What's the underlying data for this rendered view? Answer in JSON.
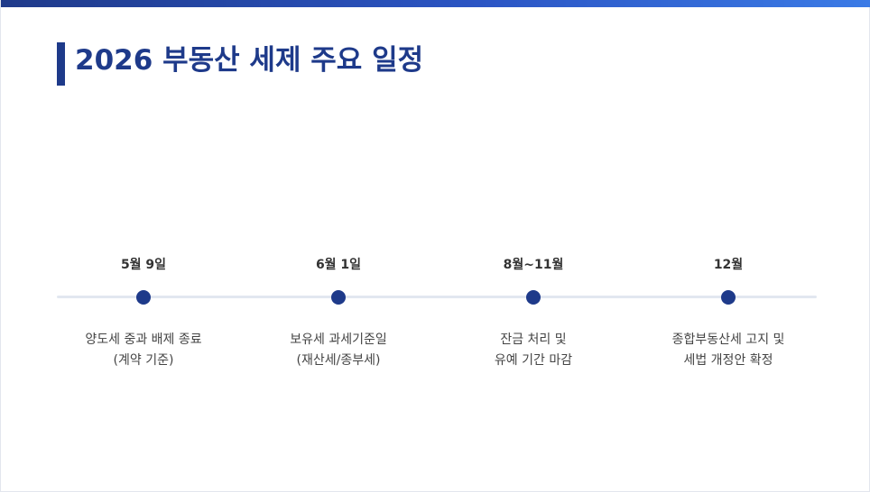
{
  "slide": {
    "title": "2026 부동산 세제 주요 일정",
    "colors": {
      "accent": "#1e3a8a",
      "timeline_line": "#e2e7f0",
      "top_bar_start": "#1f3a8a",
      "top_bar_end": "#3b7be6"
    }
  },
  "timeline": [
    {
      "date": "5월 9일",
      "desc_line1": "양도세 중과 배제 종료",
      "desc_line2": "(계약 기준)"
    },
    {
      "date": "6월 1일",
      "desc_line1": "보유세 과세기준일",
      "desc_line2": "(재산세/종부세)"
    },
    {
      "date": "8월~11월",
      "desc_line1": "잔금 처리 및",
      "desc_line2": "유예 기간 마감"
    },
    {
      "date": "12월",
      "desc_line1": "종합부동산세 고지 및",
      "desc_line2": "세법 개정안 확정"
    }
  ]
}
